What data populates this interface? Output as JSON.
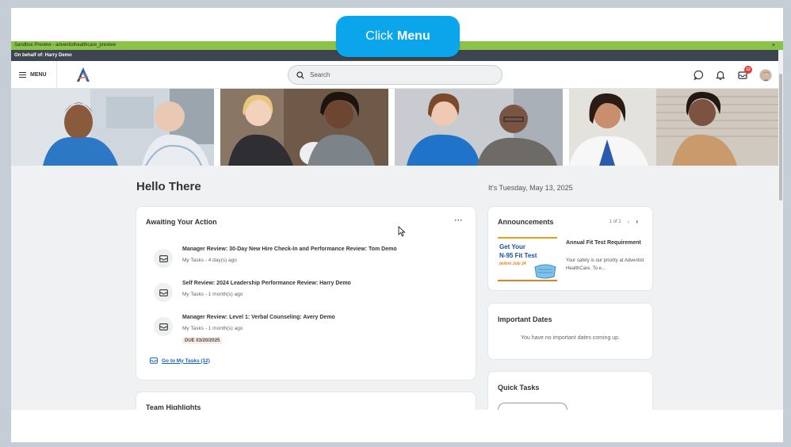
{
  "callout": {
    "prefix": "Click",
    "target": "Menu"
  },
  "sandbox": {
    "label": "Sandbox Preview - adventisthealthcare_preview",
    "close": "×"
  },
  "behalf": {
    "label": "On behalf of: Harry Demo"
  },
  "header": {
    "menu_label": "MENU",
    "search_placeholder": "Search",
    "inbox_badge": "12",
    "icons": [
      "chat-icon",
      "bell-icon",
      "inbox-icon",
      "avatar"
    ]
  },
  "hero": {
    "photos": [
      "nurse-with-patient",
      "therapist-with-patient",
      "nurse-with-elderly-man",
      "doctor-with-patient"
    ]
  },
  "main": {
    "greeting": "Hello There",
    "date": "It's Tuesday, May 13, 2025"
  },
  "awaiting": {
    "title": "Awaiting Your Action",
    "more": "···",
    "tasks": [
      {
        "title": "Manager Review: 30-Day New Hire Check-In and Performance Review: Tom Demo",
        "meta": "My Tasks - 4 day(s) ago"
      },
      {
        "title": "Self Review: 2024 Leadership Performance Review: Harry Demo",
        "meta": "My Tasks - 1 month(s) ago"
      },
      {
        "title": "Manager Review: Level 1: Verbal Counseling: Avery Demo",
        "meta": "My Tasks - 1 month(s) ago",
        "due": "DUE 03/20/2025"
      }
    ],
    "goto": "Go to My Tasks (12)"
  },
  "team": {
    "title": "Team Highlights"
  },
  "announcements": {
    "title": "Announcements",
    "pager": "1 of 2",
    "image_lines": [
      "Get Your",
      "N-95 Fit Test",
      "before July 24"
    ],
    "headline": "Annual Fit Test Requirement",
    "body": "Your safety is our priority at Adventist HealthCare. To e..."
  },
  "important_dates": {
    "title": "Important Dates",
    "empty": "You have no important dates coming up."
  },
  "quick_tasks": {
    "title": "Quick Tasks"
  },
  "colors": {
    "sandbox_green": "#8bc34a",
    "behalf_bar": "#3d4650",
    "callout_blue": "#0ba5ec",
    "link_blue": "#1565c0",
    "badge_red": "#e53935"
  }
}
